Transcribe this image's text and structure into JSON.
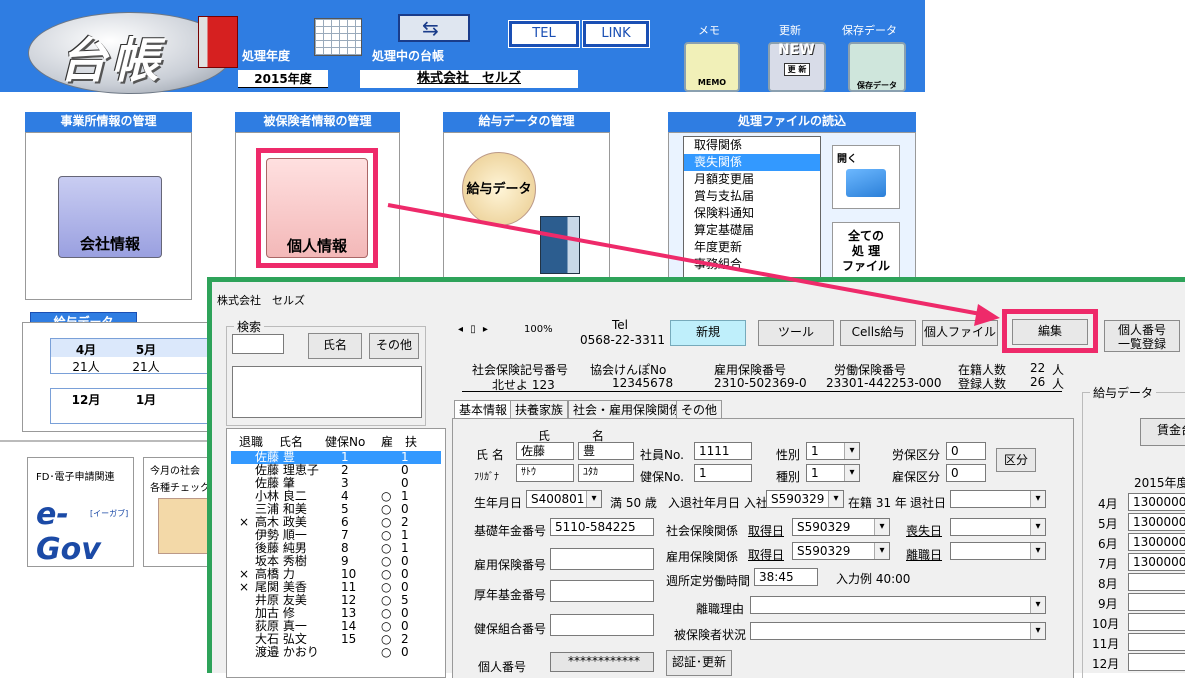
{
  "header": {
    "process_year_label": "処理年度",
    "process_year": "2015年度",
    "current_ledger_label": "処理中の台帳",
    "current_company": "株式会社　セルズ",
    "tel_button": "TEL",
    "link_button": "LINK",
    "memo_label": "メモ",
    "memo_icon_text": "MEMO",
    "update_label": "更新",
    "update_icon_text": "更 新",
    "update_new": "NEW",
    "save_label": "保存データ",
    "save_icon_text": "保存データ",
    "logo_text": "台帳"
  },
  "sections": {
    "office": {
      "title": "事業所情報の管理",
      "button": "会社情報"
    },
    "insured": {
      "title": "被保険者情報の管理",
      "button": "個人情報"
    },
    "salary": {
      "title": "給与データの管理",
      "button": "給与データ"
    },
    "files": {
      "title": "処理ファイルの読込",
      "items": [
        "取得関係",
        "喪失関係",
        "月額変更届",
        "賞与支払届",
        "保険料通知",
        "算定基礎届",
        "年度更新",
        "事務組合"
      ],
      "selected_index": 1,
      "open_button": "開く",
      "all_button": [
        "全ての",
        "処 理",
        "ファイル"
      ]
    }
  },
  "salary_box": {
    "title": "給与データ",
    "headers1": [
      "4月",
      "5月"
    ],
    "values1": [
      "21人",
      "21人"
    ],
    "headers2": [
      "12月",
      "1月"
    ]
  },
  "egov": {
    "label": "FD･電子申請関連",
    "logo": "e-Gov",
    "logo_sub": "[イーガブ]"
  },
  "monthly": {
    "label1": "今月の社会",
    "label2": "各種チェック"
  },
  "front": {
    "company": "株式会社　セルズ",
    "search": {
      "label": "検索",
      "name_button": "氏名",
      "other_button": "その他"
    },
    "list_headers": [
      "退職",
      "氏名",
      "健保No",
      "雇",
      "扶"
    ],
    "employees": [
      {
        "ret": "",
        "name": "佐藤 豊",
        "no": "1",
        "koyo": "",
        "fu": "1"
      },
      {
        "ret": "",
        "name": "佐藤 理恵子",
        "no": "2",
        "koyo": "",
        "fu": "0"
      },
      {
        "ret": "",
        "name": "佐藤 肇",
        "no": "3",
        "koyo": "",
        "fu": "0"
      },
      {
        "ret": "",
        "name": "小林 良二",
        "no": "4",
        "koyo": "○",
        "fu": "1"
      },
      {
        "ret": "",
        "name": "三浦 和美",
        "no": "5",
        "koyo": "○",
        "fu": "0"
      },
      {
        "ret": "×",
        "name": "高木 政美",
        "no": "6",
        "koyo": "○",
        "fu": "2"
      },
      {
        "ret": "",
        "name": "伊勢 順一",
        "no": "7",
        "koyo": "○",
        "fu": "1"
      },
      {
        "ret": "",
        "name": "後藤 純男",
        "no": "8",
        "koyo": "○",
        "fu": "1"
      },
      {
        "ret": "",
        "name": "坂本 秀樹",
        "no": "9",
        "koyo": "○",
        "fu": "0"
      },
      {
        "ret": "×",
        "name": "高橋 力",
        "no": "10",
        "koyo": "○",
        "fu": "0"
      },
      {
        "ret": "×",
        "name": "尾関 美香",
        "no": "11",
        "koyo": "○",
        "fu": "0"
      },
      {
        "ret": "",
        "name": "井原 友美",
        "no": "12",
        "koyo": "○",
        "fu": "5"
      },
      {
        "ret": "",
        "name": "加古 修",
        "no": "13",
        "koyo": "○",
        "fu": "0"
      },
      {
        "ret": "",
        "name": "荻原 真一",
        "no": "14",
        "koyo": "○",
        "fu": "0"
      },
      {
        "ret": "",
        "name": "大石 弘文",
        "no": "15",
        "koyo": "○",
        "fu": "2"
      },
      {
        "ret": "",
        "name": "渡邉 かおり",
        "no": "",
        "koyo": "○",
        "fu": "0"
      }
    ],
    "zoom": "100%",
    "tel_label": "Tel",
    "tel": "0568-22-3311",
    "buttons": {
      "new": "新規",
      "tool": "ツール",
      "cells": "Cells給与",
      "personal": "個人ファイル",
      "edit": "編集",
      "mynumber": [
        "個人番号",
        "一覧登録"
      ]
    },
    "info": {
      "shaho_label": "社会保険記号番号",
      "shaho": "北せよ 123",
      "kyokai_label": "協会けんぽNo",
      "kyokai": "12345678",
      "koyo_label": "雇用保険番号",
      "koyo": "2310-502369-0",
      "rodo_label": "労働保険番号",
      "rodo": "23301-442253-000",
      "zaiseki_label": "在籍人数",
      "zaiseki": "22",
      "toroku_label": "登録人数",
      "toroku": "26",
      "nin": "人"
    },
    "tabs": [
      "基本情報",
      "扶養家族",
      "社会・雇用保険関係",
      "その他"
    ],
    "form": {
      "shi": "氏",
      "mei": "名",
      "name_label": "氏 名",
      "last": "佐藤",
      "first": "豊",
      "furi_label": "ﾌﾘｶﾞﾅ",
      "furi_last": "ｻﾄｳ",
      "furi_first": "ﾕﾀｶ",
      "emp_no_label": "社員No.",
      "emp_no": "1111",
      "kenpo_label": "健保No.",
      "kenpo": "1",
      "sex_label": "性別",
      "sex": "1",
      "type_label": "種別",
      "type": "1",
      "rohok_label": "労保区分",
      "rohok": "0",
      "koyok_label": "雇保区分",
      "koyok": "0",
      "kubun_button": "区分",
      "birth_label": "生年月日",
      "birth": "S400801",
      "age": "満 50 歳",
      "join_label": "入退社年月日 入社",
      "join": "S590329",
      "tenure": "在籍 31 年",
      "retire_label": "退社日",
      "kiso_label": "基礎年金番号",
      "kiso": "5110-584225",
      "shaho_rel": "社会保険関係",
      "acquire": "取得日",
      "shaho_date": "S590329",
      "loss": "喪失日",
      "koyo_no_label": "雇用保険番号",
      "koyo_rel": "雇用保険関係",
      "koyo_date": "S590329",
      "leave": "離職日",
      "weekly_label": "週所定労働時間",
      "weekly": "38:45",
      "example": "入力例 40:00",
      "kosei_label": "厚年基金番号",
      "reason_label": "離職理由",
      "kenpo_kumiai_label": "健保組合番号",
      "status_label": "被保険者状況",
      "mynumber_label": "個人番号",
      "mynumber": "************",
      "auth_button": "認証･更新"
    },
    "salary_panel": {
      "title": "給与データ",
      "button": "賃金台",
      "year": "2015年度",
      "months": [
        "4月",
        "5月",
        "6月",
        "7月",
        "8月",
        "9月",
        "10月",
        "11月",
        "12月"
      ],
      "values": [
        "1300000",
        "1300000",
        "1300000",
        "1300000",
        "",
        "",
        "",
        "",
        ""
      ]
    }
  },
  "colors": {
    "header_blue": "#2f7de2",
    "highlight": "#ee2a6a",
    "front_border": "#2ea35a"
  }
}
